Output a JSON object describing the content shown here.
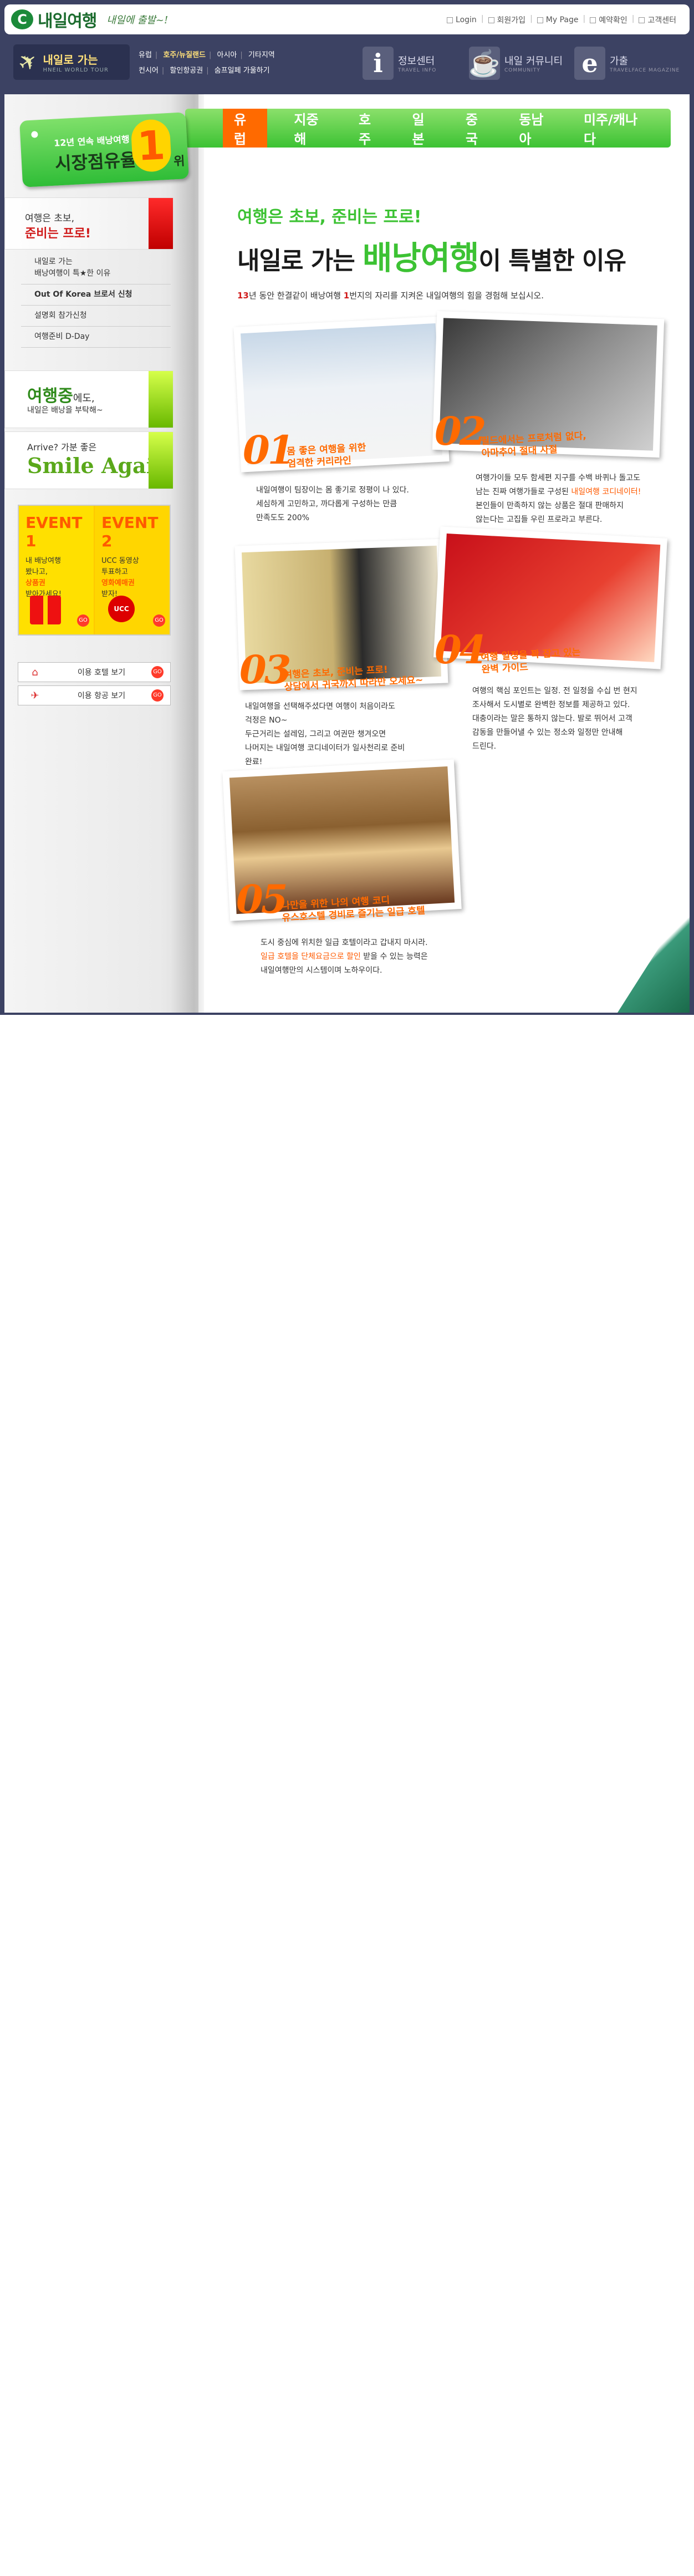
{
  "header": {
    "brand": "내일여행",
    "slogan": "내일에 출발~!",
    "toplinks": [
      "Login",
      "회원가입",
      "My Page",
      "예약확인",
      "고객센터"
    ],
    "tour_box": {
      "title": "내일로 가는",
      "subtitle": "HNEIL WORLD TOUR"
    },
    "regions_row1": [
      "유럽",
      "호주/뉴질랜드",
      "아시아",
      "기타지역"
    ],
    "regions_row2": [
      "컨시어",
      "할인항공권",
      "숨프일페 가울하기"
    ],
    "info": [
      {
        "icon": "i",
        "label": "정보센터",
        "sub": "TRAVEL INFO"
      },
      {
        "icon": "☕",
        "label": "내일 커뮤니티",
        "sub": "COMMUNITY"
      },
      {
        "icon": "e",
        "label": "가출",
        "sub": "TRAVELFACE MAGAZINE"
      }
    ]
  },
  "ribbon": {
    "line1": "12년 연속 배낭여행",
    "line2": "시장점유율",
    "number": "1",
    "suffix": "위"
  },
  "tabs": [
    "유럽",
    "지중해",
    "호주",
    "일본",
    "중국",
    "동남아",
    "미주/캐나다"
  ],
  "sidebar": {
    "heading_a": "여행은 초보,",
    "heading_b": "준비는 프로!",
    "menu": [
      {
        "line1": "내일로 가는",
        "line2": "배낭여행이 특★한 이유"
      },
      {
        "line1": "Out Of Korea 브로서 신청"
      },
      {
        "line1": "설명회 참가신청"
      },
      {
        "line1": "여행준비 D-Day"
      }
    ],
    "promo1": {
      "big": "여행중",
      "small": "에도,",
      "sub": "내일은 배낭을 부탁해~"
    },
    "promo2": {
      "a": "Arrive? 가분 좋은",
      "b": "Smile Again"
    },
    "events": [
      {
        "title": "EVENT 1",
        "body": [
          "내 배낭여행",
          "봤나고,"
        ],
        "hi": "상품권",
        "tail": "받아가세요!"
      },
      {
        "title": "EVENT 2",
        "body": [
          "UCC 동영상",
          "투표하고"
        ],
        "hi": "영화예매권",
        "tail": "받자!"
      }
    ],
    "hotel_button": "이용 호텔 보기",
    "air_button": "이용 항공 보기"
  },
  "main": {
    "headline1": "여행은 초보, 준비는 프로!",
    "headline2_a": "내일로 가는 ",
    "headline2_b": "배낭여행",
    "headline2_c": "이 특별한 이유",
    "intro_a": "13",
    "intro_b": "년 동안 한결같이 배낭여행 ",
    "intro_c": "1",
    "intro_d": "번지의 자리를 지켜온 내일여행의 힘을 경험해 보십시오.",
    "reasons": [
      {
        "num": "01",
        "cap": [
          "몸 좋은 여행을 위한",
          "엄격한 커리라인"
        ],
        "desc": [
          "내일여행이 팀장이는 몸 좋기로 정평이 나 있다.",
          "세심하게 고민하고, 까다롭게 구성하는 만큼",
          "만족도도 200%"
        ]
      },
      {
        "num": "02",
        "cap": [
          "필드에서는 프로처럼 없다,",
          "아마추어 절대 사절"
        ],
        "desc": [
          "여행가이들 모두 함세편 지구를 수백 바퀴나 돌고도",
          "남는 진짜 여행가들로 구성된 ",
          "내일여행 코디네이터!",
          "본인들이 만족하지 않는 상품은 절대 판매하지",
          "않는다는 고집들 우린 프로라고 부른다."
        ]
      },
      {
        "num": "03",
        "cap": [
          "여행은 초보, 준비는 프로!",
          "상담에서 귀국까지 따라만 오세요~"
        ],
        "desc": [
          "내일여행을 선택해주셨다면 여행이 처음이라도",
          "걱정은 NO~",
          "두근거리는 설레임, 그리고 여권만 챙겨오면",
          "나머지는 내일여행 코디네이터가 일사천리로 준비",
          "완료!"
        ]
      },
      {
        "num": "04",
        "cap": [
          "여행 일정을 꽉 잡고 있는",
          "완벽 가이드"
        ],
        "desc": [
          "여행의 핵심 포인트는 일정. 전 일정을 수십 번 현지",
          "조사해서 도시별로 완벽한 정보를 제공하고 있다.",
          "대충이라는 말은 통하지 않는다. 발로 뛰어서 고객",
          "감동을 만들어낼 수 있는 정소와 일정만 안내해",
          "드린다."
        ]
      },
      {
        "num": "05",
        "cap": [
          "나만을 위한 나의 여행 코디",
          "유스호스텔 경비로 즐기는 일급 호텔"
        ],
        "desc": [
          "도시 중심에 위치한 일급 호텔이라고 갑내지 마시라.",
          "일급 호텔을 단체요금으로 할인",
          " 받을 수 있는 능력은",
          "내일여행만의 시스템이며 노하우이다."
        ]
      }
    ]
  }
}
